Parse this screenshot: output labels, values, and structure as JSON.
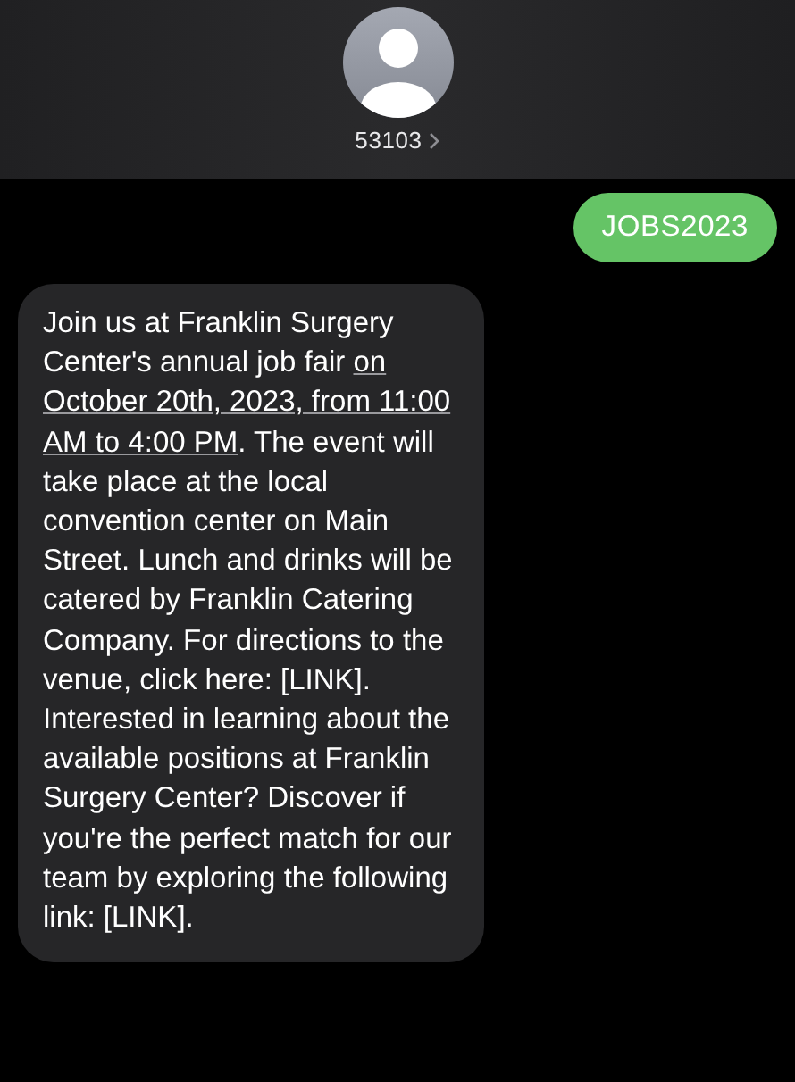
{
  "header": {
    "contact": "53103"
  },
  "messages": [
    {
      "kind": "sent",
      "lines": [
        [
          {
            "kind": "text",
            "text": "JOBS2023"
          }
        ]
      ]
    },
    {
      "kind": "received",
      "lines": [
        [
          {
            "kind": "text",
            "text": "Join us at Franklin Surgery"
          }
        ],
        [
          {
            "kind": "text",
            "text": "Center's annual job fair "
          },
          {
            "kind": "link",
            "text": "on"
          }
        ],
        [
          {
            "kind": "link",
            "text": "October 20th, 2023, from 11:00"
          }
        ],
        [
          {
            "kind": "link",
            "text": "AM to 4:00 PM"
          },
          {
            "kind": "text",
            "text": ". The event will"
          }
        ],
        [
          {
            "kind": "text",
            "text": "take place at the local"
          }
        ],
        [
          {
            "kind": "text",
            "text": "convention center on Main"
          }
        ],
        [
          {
            "kind": "text",
            "text": "Street. Lunch and drinks will be"
          }
        ],
        [
          {
            "kind": "text",
            "text": "catered by Franklin Catering"
          }
        ],
        [
          {
            "kind": "text",
            "text": "Company. For directions to the"
          }
        ],
        [
          {
            "kind": "text",
            "text": "venue, click here: [LINK]."
          }
        ],
        [
          {
            "kind": "text",
            "text": "Interested in learning about the"
          }
        ],
        [
          {
            "kind": "text",
            "text": "available positions at Franklin"
          }
        ],
        [
          {
            "kind": "text",
            "text": "Surgery Center? Discover if"
          }
        ],
        [
          {
            "kind": "text",
            "text": "you're the perfect match for our"
          }
        ],
        [
          {
            "kind": "text",
            "text": "team by exploring the following"
          }
        ],
        [
          {
            "kind": "text",
            "text": "link: [LINK]."
          }
        ]
      ]
    }
  ]
}
